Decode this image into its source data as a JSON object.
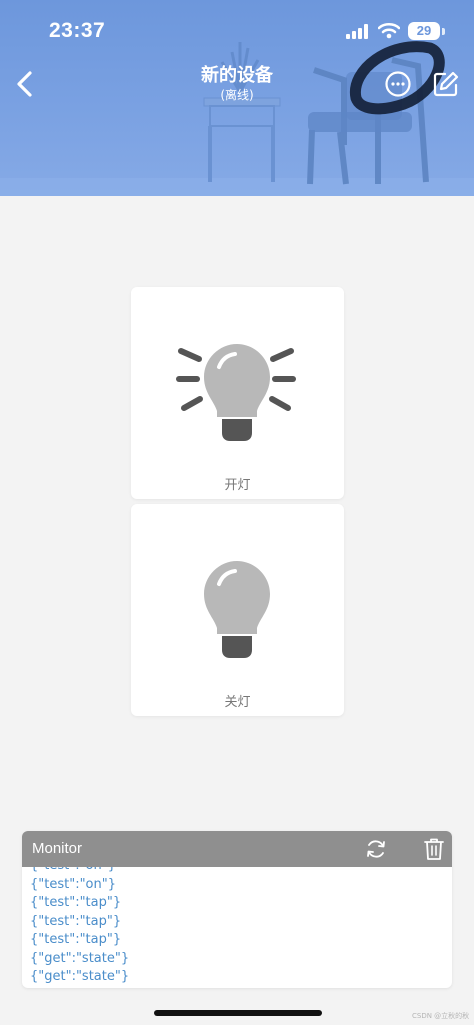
{
  "status_bar": {
    "time": "23:37",
    "battery": "29"
  },
  "header": {
    "title": "新的设备",
    "subtitle": "(离线)",
    "back_icon": "chevron-left-icon",
    "more_icon": "more-horizontal-icon",
    "edit_icon": "edit-icon"
  },
  "cards": [
    {
      "label": "开灯",
      "icon": "bulb-on-icon"
    },
    {
      "label": "关灯",
      "icon": "bulb-off-icon"
    }
  ],
  "monitor": {
    "title": "Monitor",
    "refresh_icon": "refresh-icon",
    "delete_icon": "trash-icon",
    "log": [
      "{\"test\":\"on\"}",
      "{\"test\":\"on\"}",
      "{\"test\":\"tap\"}",
      "{\"test\":\"tap\"}",
      "{\"test\":\"tap\"}",
      "{\"get\":\"state\"}",
      "{\"get\":\"state\"}"
    ]
  },
  "watermark": "CSDN @立秋的秋",
  "colors": {
    "header": "#6d97dc",
    "monitor_header": "#8f8f8f",
    "log_text": "#4a8dca",
    "bulb": "#b8b8b8",
    "bulb_base": "#555555",
    "background": "#f3f3f3"
  }
}
